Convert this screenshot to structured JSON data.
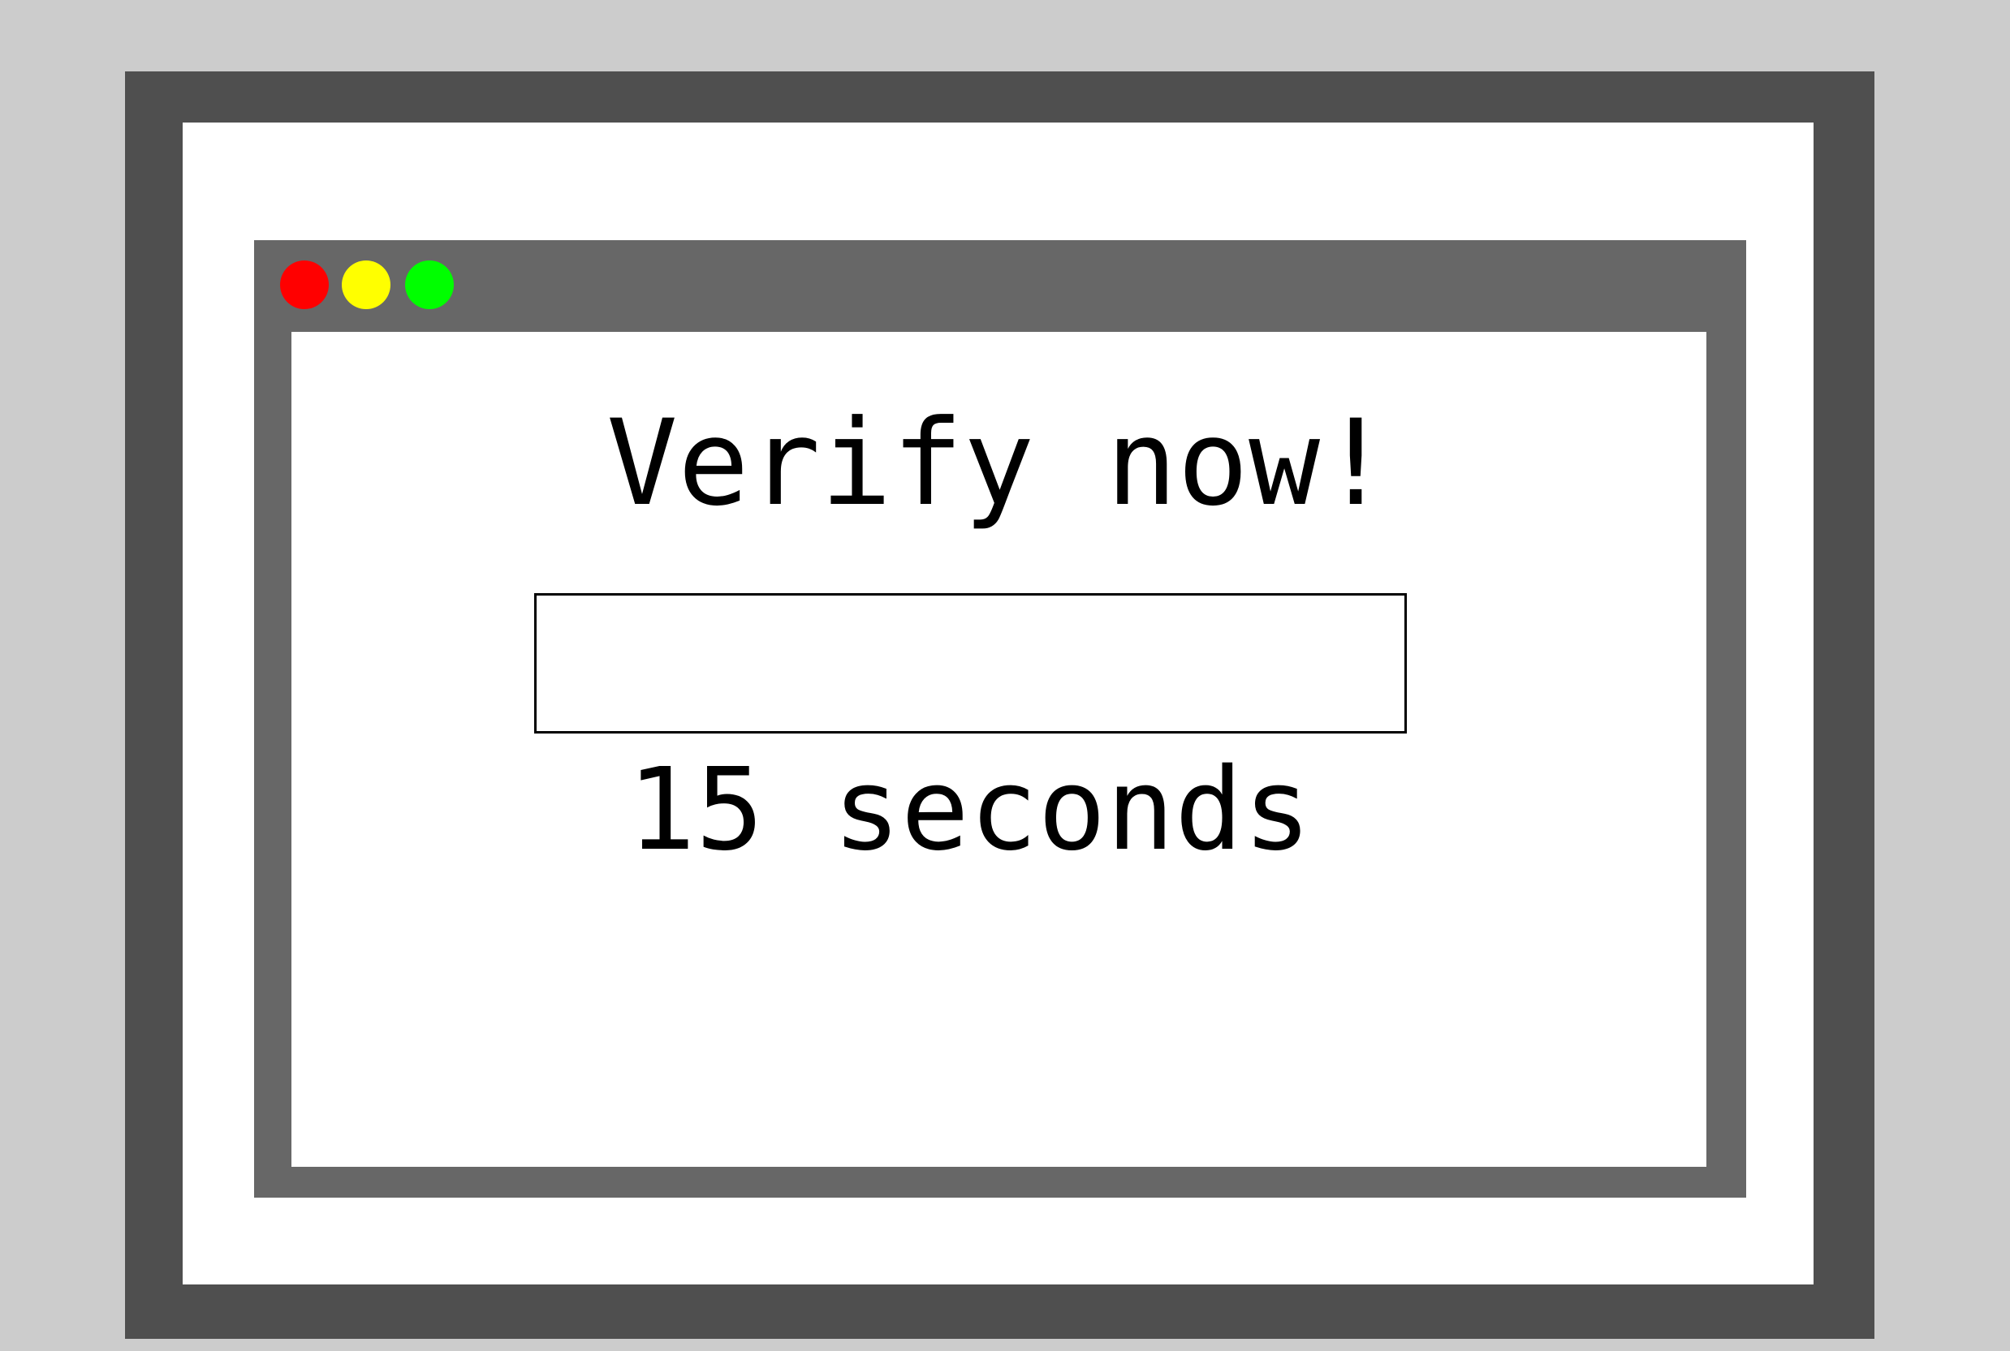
{
  "window": {
    "controls": [
      {
        "name": "close",
        "color": "#ff0000"
      },
      {
        "name": "minimize",
        "color": "#ffff00"
      },
      {
        "name": "maximize",
        "color": "#00ff00"
      }
    ]
  },
  "dialog": {
    "title": "Verify now!",
    "input": {
      "value": "",
      "placeholder": ""
    },
    "countdown_text": "15 seconds"
  },
  "colors": {
    "background": "#cccccc",
    "monitor_bezel": "#4f4f4f",
    "window_frame": "#676767",
    "content": "#ffffff"
  }
}
